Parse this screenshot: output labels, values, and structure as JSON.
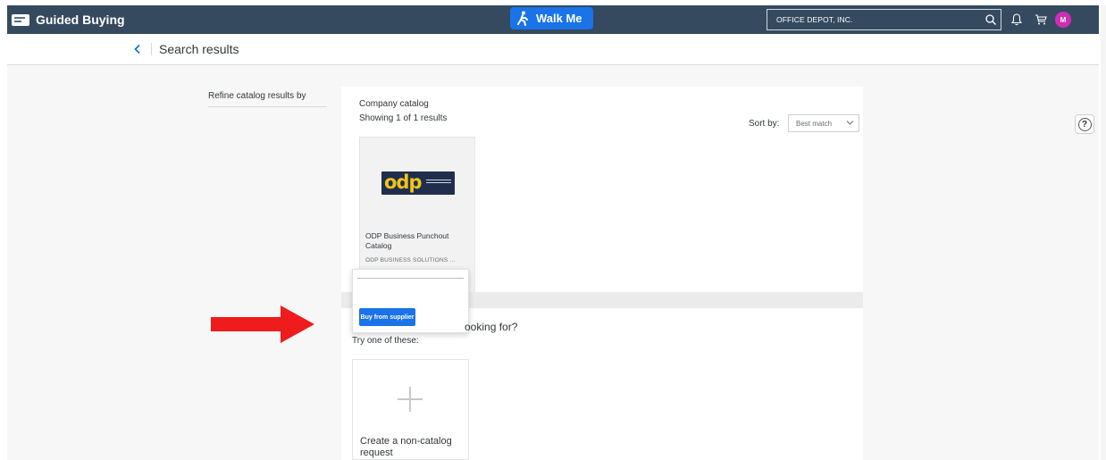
{
  "header": {
    "app_title": "Guided Buying",
    "walkme_label": "Walk Me",
    "search_value": "OFFICE DEPOT, INC.",
    "avatar_initial": "M",
    "colors": {
      "bar": "#354a5f",
      "accent": "#1a73e8",
      "avatar": "#d02db7"
    }
  },
  "subheader": {
    "title": "Search results"
  },
  "sidebar": {
    "refine_label": "Refine catalog results by"
  },
  "catalog": {
    "heading": "Company catalog",
    "results_count": "Showing 1 of 1 results",
    "sort_label": "Sort by:",
    "sort_value": "Best match",
    "items": [
      {
        "logo_text": "odp",
        "title": "ODP Business Punchout Catalog",
        "supplier": "ODP BUSINESS SOLUTIONS ..."
      }
    ]
  },
  "popup": {
    "buy_label": "Buy from supplier"
  },
  "suggestions": {
    "heading_partial": "ooking for?",
    "try_text": "Try one of these:",
    "noncatalog_label": "Create a non-catalog request"
  },
  "icons": [
    "search-icon",
    "bell-icon",
    "cart-icon",
    "back-icon",
    "help-icon",
    "plus-icon",
    "walk-icon",
    "chevron-down-icon"
  ],
  "annotation": {
    "arrow_color": "#ee1c1c"
  }
}
